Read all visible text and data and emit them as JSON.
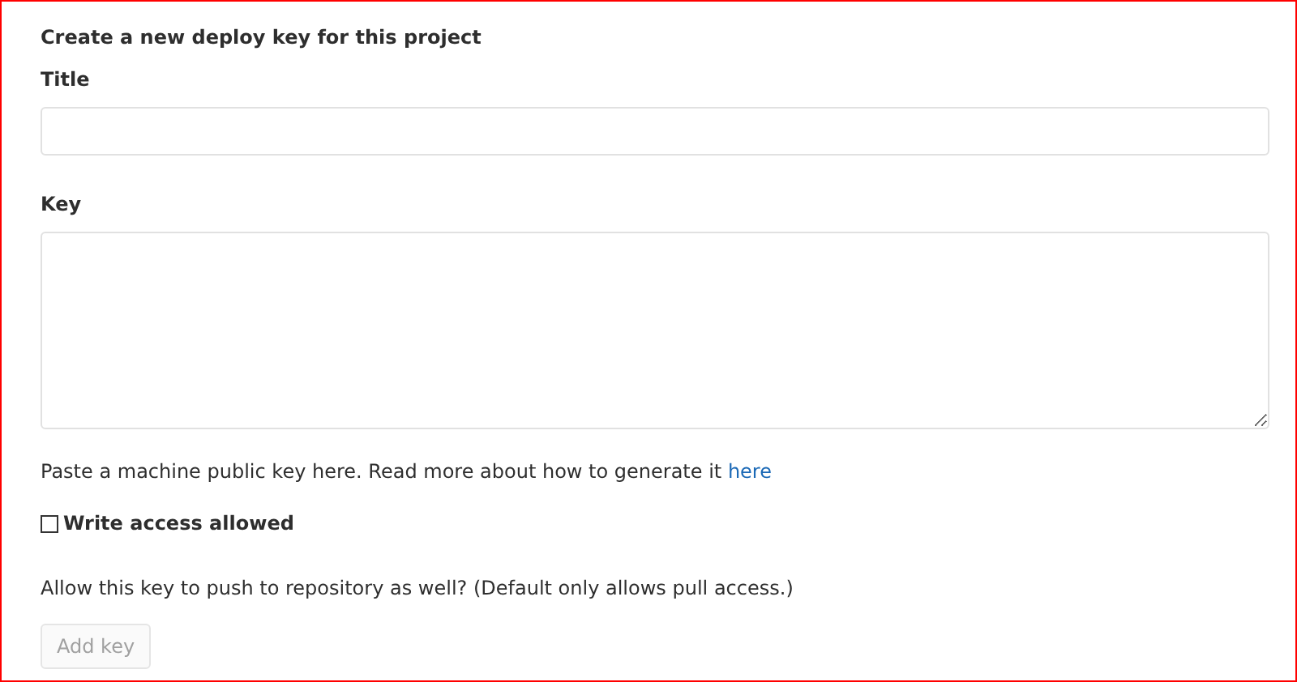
{
  "heading": "Create a new deploy key for this project",
  "title_field": {
    "label": "Title"
  },
  "key_field": {
    "label": "Key"
  },
  "key_help": {
    "text": "Paste a machine public key here. Read more about how to generate it ",
    "link": "here"
  },
  "write_access": {
    "label": "Write access allowed",
    "checked": false
  },
  "write_access_help": "Allow this key to push to repository as well? (Default only allows pull access.)",
  "submit": {
    "label": "Add key",
    "disabled": true
  }
}
